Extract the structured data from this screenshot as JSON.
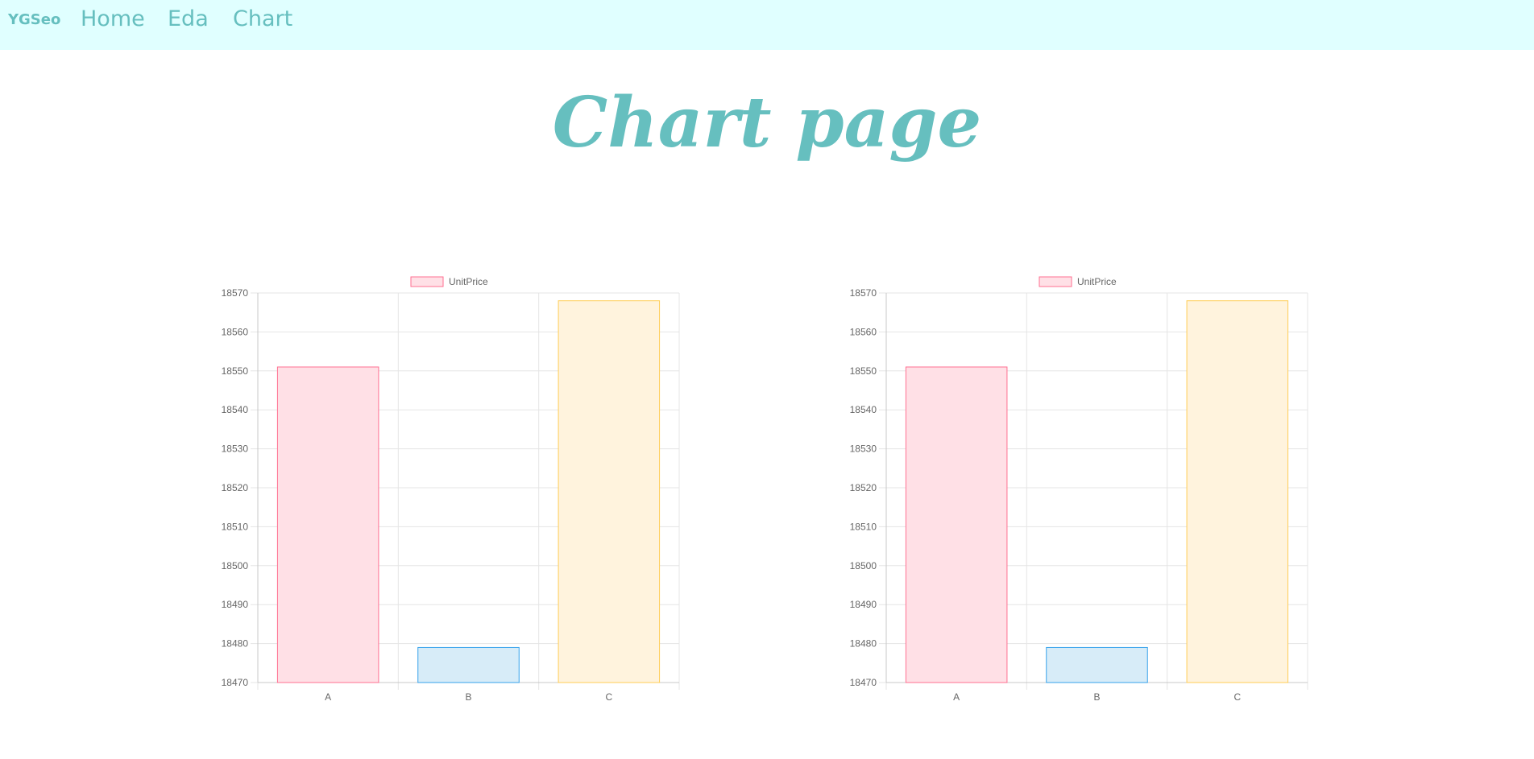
{
  "nav": {
    "brand": "YGSeo",
    "links": [
      "Home",
      "Eda",
      "Chart"
    ]
  },
  "page": {
    "title": "Chart page"
  },
  "chart_data": [
    {
      "type": "bar",
      "categories": [
        "A",
        "B",
        "C"
      ],
      "series": [
        {
          "name": "UnitPrice",
          "values": [
            18551,
            18479,
            18568
          ]
        }
      ],
      "ylim": [
        18470,
        18570
      ],
      "yticks": [
        18570,
        18560,
        18550,
        18540,
        18530,
        18520,
        18510,
        18500,
        18490,
        18480,
        18470
      ],
      "grid": true,
      "legend": "top",
      "bar_fill": [
        "#ffe0e6",
        "#d7ecf8",
        "#fff3dd"
      ],
      "bar_stroke": [
        "#ff6f91",
        "#36a2eb",
        "#ffcd56"
      ],
      "title": "",
      "xlabel": "",
      "ylabel": ""
    },
    {
      "type": "bar",
      "categories": [
        "A",
        "B",
        "C"
      ],
      "series": [
        {
          "name": "UnitPrice",
          "values": [
            18551,
            18479,
            18568
          ]
        }
      ],
      "ylim": [
        18470,
        18570
      ],
      "yticks": [
        18570,
        18560,
        18550,
        18540,
        18530,
        18520,
        18510,
        18500,
        18490,
        18480,
        18470
      ],
      "grid": true,
      "legend": "top",
      "bar_fill": [
        "#ffe0e6",
        "#d7ecf8",
        "#fff3dd"
      ],
      "bar_stroke": [
        "#ff6f91",
        "#36a2eb",
        "#ffcd56"
      ],
      "title": "",
      "xlabel": "",
      "ylabel": ""
    }
  ]
}
